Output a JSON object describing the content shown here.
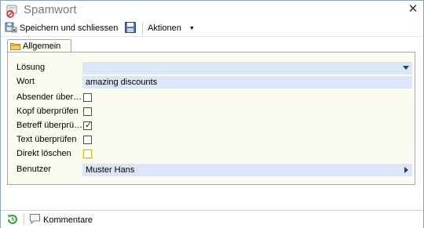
{
  "window": {
    "title": "Spamwort",
    "close_symbol": "✕"
  },
  "toolbar": {
    "save_close_label": "Speichern und schliessen",
    "actions_label": "Aktionen",
    "actions_caret": "▼"
  },
  "tabs": [
    {
      "label": "Allgemein",
      "icon": "folder-icon"
    }
  ],
  "form": {
    "losung": {
      "label": "Lösung",
      "value": ""
    },
    "wort": {
      "label": "Wort",
      "value": "amazing discounts"
    },
    "checkboxes": [
      {
        "label": "Absender über…",
        "checked": false,
        "focused": false
      },
      {
        "label": "Kopf überprüfen",
        "checked": false,
        "focused": false
      },
      {
        "label": "Betreff überprü…",
        "checked": true,
        "focused": false
      },
      {
        "label": "Text überprüfen",
        "checked": false,
        "focused": false
      },
      {
        "label": "Direkt löschen",
        "checked": false,
        "focused": true
      }
    ],
    "benutzer": {
      "label": "Benutzer",
      "value": "Muster Hans"
    }
  },
  "statusbar": {
    "comments_label": "Kommentare"
  },
  "colors": {
    "window_border": "#8da2bd",
    "panel_bg": "#fbfbef",
    "field_bg": "#dbe7f8",
    "accent_arrow": "#2a3d66",
    "focus_border": "#d4c21a"
  }
}
